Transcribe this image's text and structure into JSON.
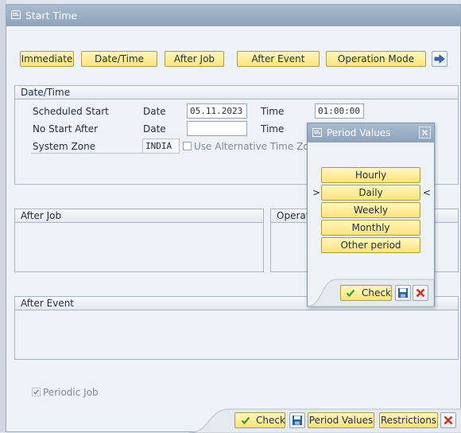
{
  "window": {
    "title": "Start Time"
  },
  "toolbar": {
    "immediate": "Immediate",
    "date_time": "Date/Time",
    "after_job": "After Job",
    "after_event": "After Event",
    "operation_mode": "Operation Mode"
  },
  "datetime_group": {
    "title": "Date/Time",
    "scheduled_start_label": "Scheduled Start",
    "no_start_after_label": "No Start After",
    "system_zone_label": "System Zone",
    "date_label": "Date",
    "time_label": "Time",
    "scheduled_date": "05.11.2023",
    "scheduled_time": "01:00:00",
    "no_start_date": "",
    "system_zone": "INDIA",
    "alt_timezone_label": "Use Alternative Time Zone"
  },
  "after_job_group": {
    "title": "After Job"
  },
  "operation_group": {
    "title": "Operat"
  },
  "after_event_group": {
    "title": "After Event"
  },
  "periodic_job": {
    "label": "Periodic Job",
    "checked": true
  },
  "footer": {
    "check": "Check",
    "period_values": "Period Values",
    "restrictions": "Restrictions"
  },
  "period_popup": {
    "title": "Period Values",
    "options": [
      "Hourly",
      "Daily",
      "Weekly",
      "Monthly",
      "Other period"
    ],
    "selected_marker_left": ">",
    "selected_marker_right": "<",
    "check": "Check"
  },
  "colors": {
    "button_yellow": "#ffe37a",
    "title_bar": "#8ea4bb",
    "check_green": "#3a9a2a",
    "cancel_red": "#d0321e",
    "save_blue": "#2c5f9e"
  }
}
